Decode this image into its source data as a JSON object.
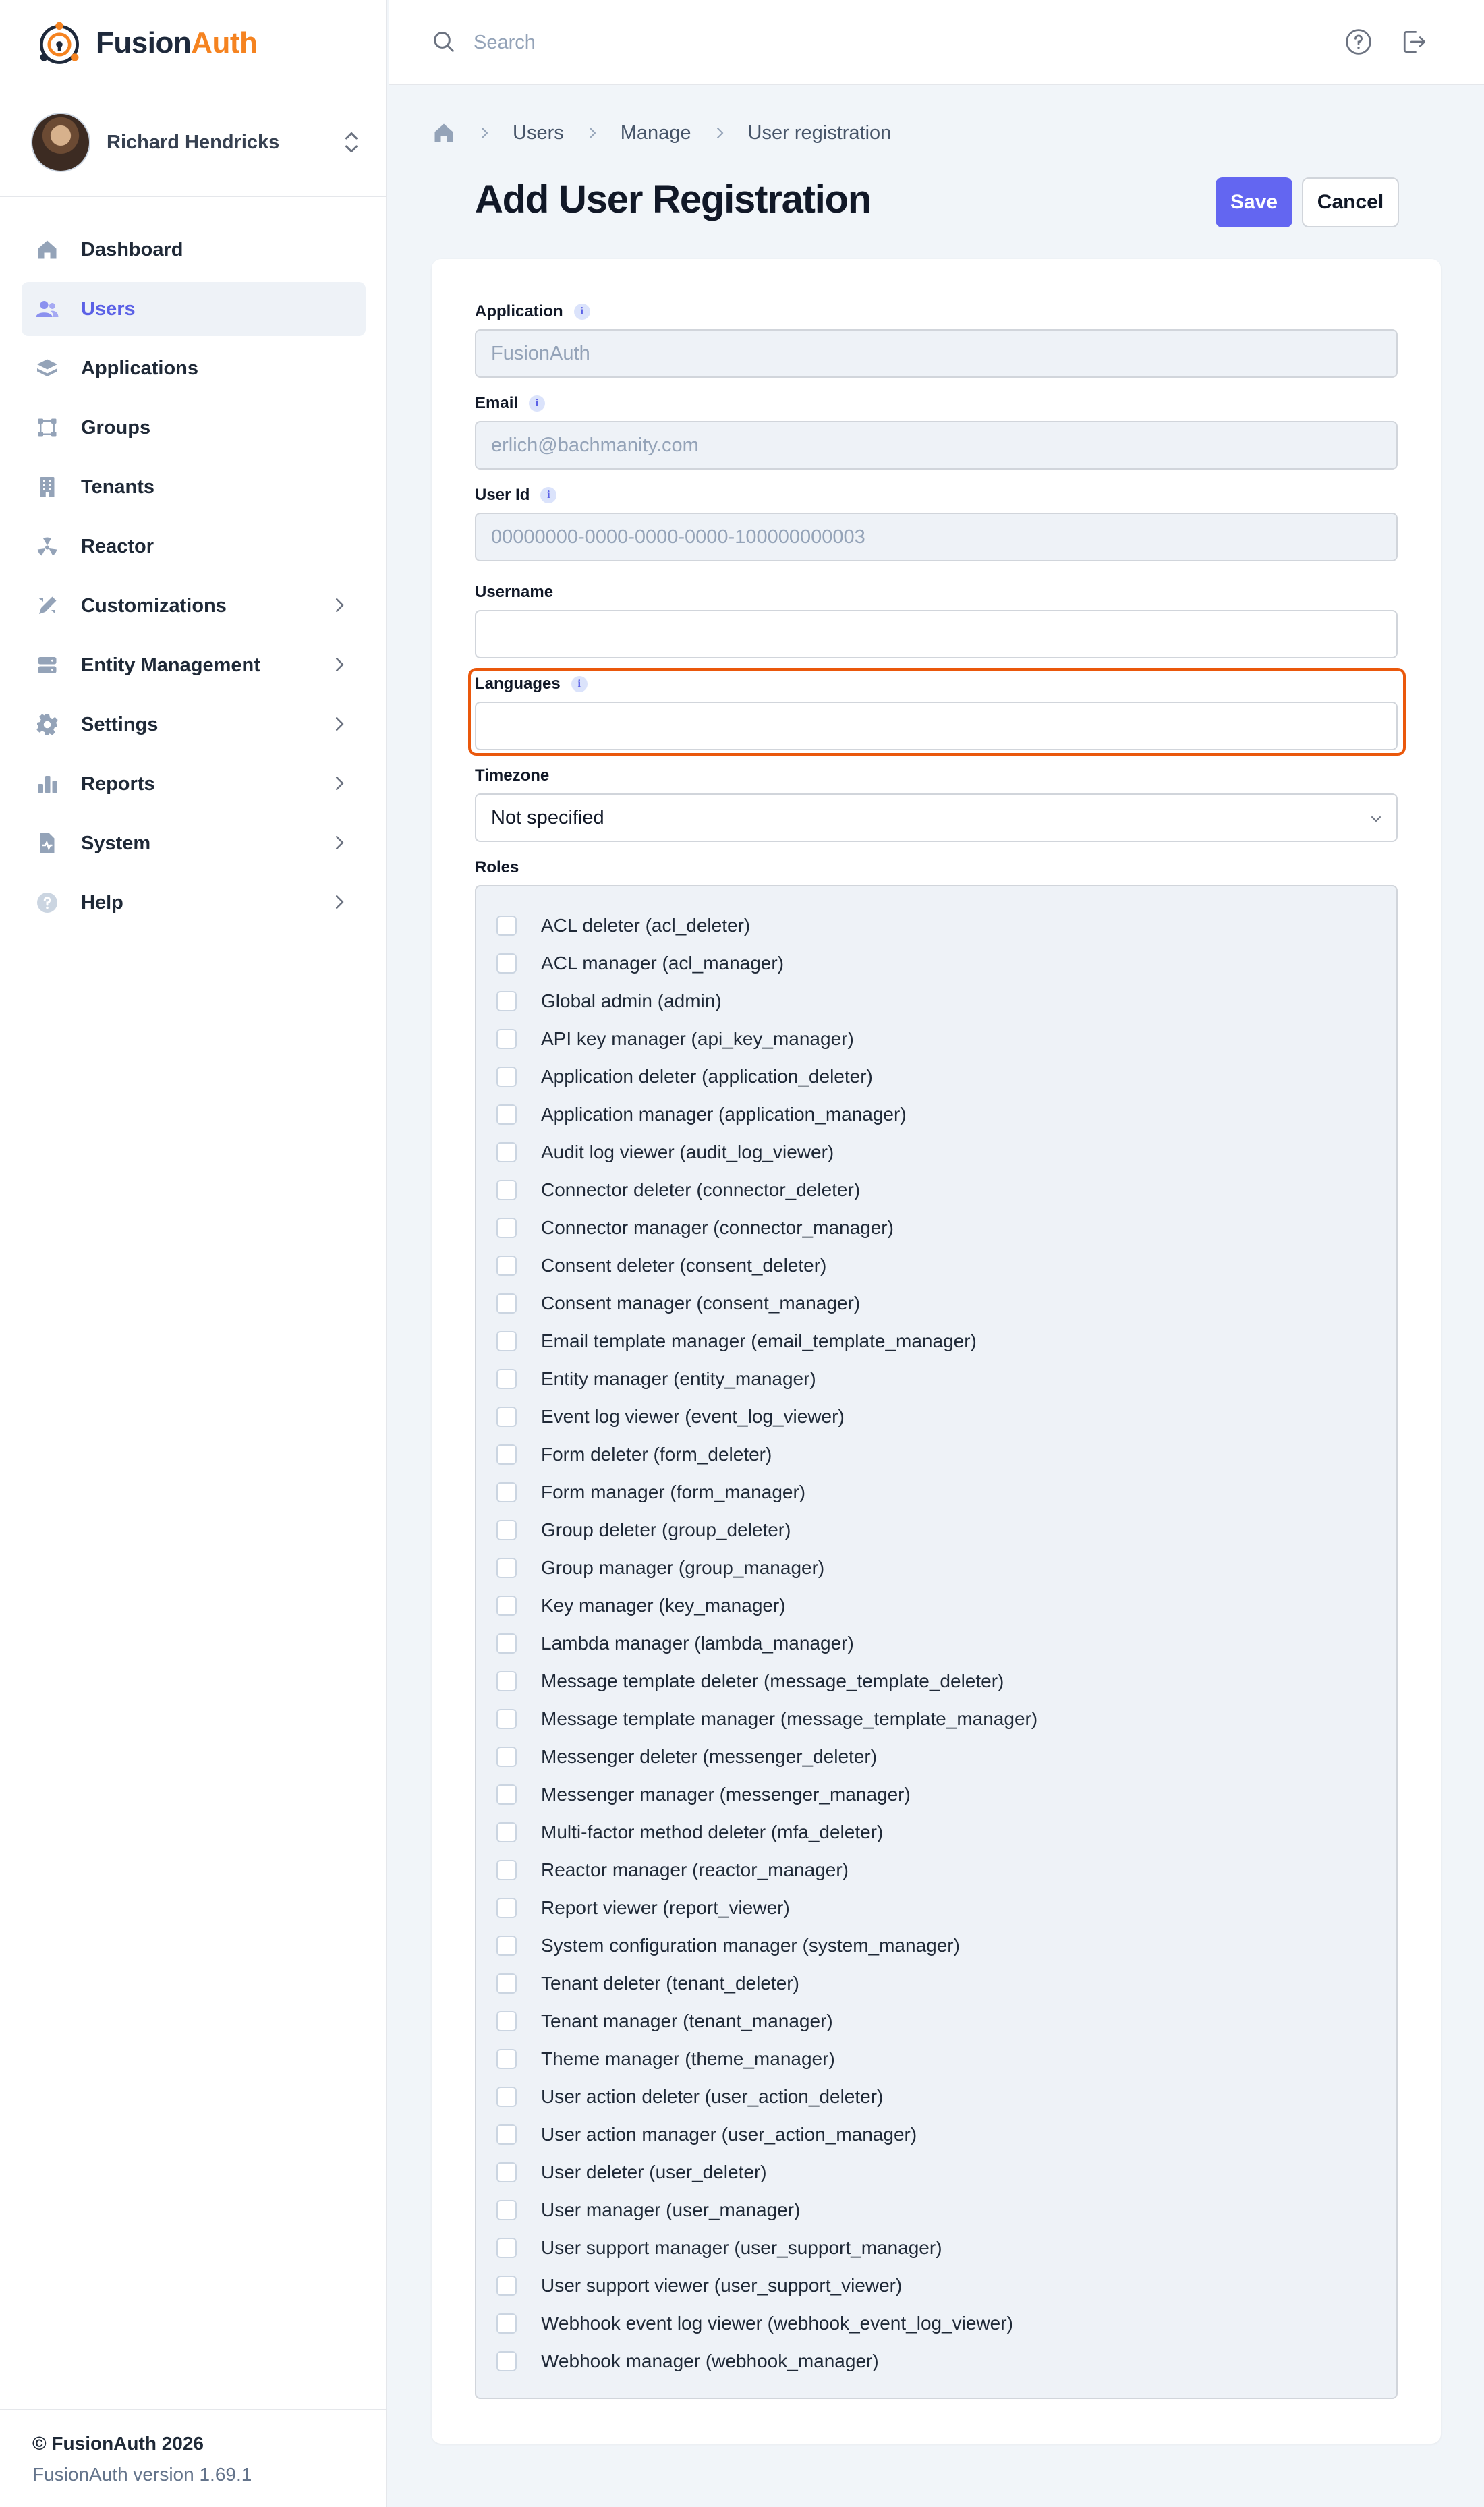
{
  "app": {
    "brand_primary": "Fusion",
    "brand_accent": "Auth",
    "accent_color": "#f58320",
    "primary_color": "#6366f1"
  },
  "user": {
    "name": "Richard Hendricks"
  },
  "nav": {
    "items": [
      {
        "label": "Dashboard",
        "icon": "home-icon"
      },
      {
        "label": "Users",
        "icon": "users-icon"
      },
      {
        "label": "Applications",
        "icon": "layers-icon"
      },
      {
        "label": "Groups",
        "icon": "groups-icon"
      },
      {
        "label": "Tenants",
        "icon": "building-icon"
      },
      {
        "label": "Reactor",
        "icon": "radiation-icon"
      },
      {
        "label": "Customizations",
        "icon": "pencil-ruler-icon"
      },
      {
        "label": "Entity Management",
        "icon": "server-icon"
      },
      {
        "label": "Settings",
        "icon": "gear-icon"
      },
      {
        "label": "Reports",
        "icon": "bar-chart-icon"
      },
      {
        "label": "System",
        "icon": "document-pulse-icon"
      },
      {
        "label": "Help",
        "icon": "question-icon"
      }
    ]
  },
  "footer": {
    "copyright": "© FusionAuth 2026",
    "version": "FusionAuth version 1.69.1"
  },
  "search": {
    "placeholder": "Search"
  },
  "breadcrumb": {
    "items": [
      "Users",
      "Manage",
      "User registration"
    ]
  },
  "page": {
    "title": "Add User Registration",
    "save_label": "Save",
    "cancel_label": "Cancel"
  },
  "form": {
    "application": {
      "label": "Application",
      "value": "FusionAuth"
    },
    "email": {
      "label": "Email",
      "value": "erlich@bachmanity.com"
    },
    "user_id": {
      "label": "User Id",
      "value": "00000000-0000-0000-0000-100000000003"
    },
    "username": {
      "label": "Username",
      "value": ""
    },
    "languages": {
      "label": "Languages",
      "value": ""
    },
    "timezone": {
      "label": "Timezone",
      "value": "Not specified"
    },
    "roles": {
      "label": "Roles",
      "items": [
        "ACL deleter (acl_deleter)",
        "ACL manager (acl_manager)",
        "Global admin (admin)",
        "API key manager (api_key_manager)",
        "Application deleter (application_deleter)",
        "Application manager (application_manager)",
        "Audit log viewer (audit_log_viewer)",
        "Connector deleter (connector_deleter)",
        "Connector manager (connector_manager)",
        "Consent deleter (consent_deleter)",
        "Consent manager (consent_manager)",
        "Email template manager (email_template_manager)",
        "Entity manager (entity_manager)",
        "Event log viewer (event_log_viewer)",
        "Form deleter (form_deleter)",
        "Form manager (form_manager)",
        "Group deleter (group_deleter)",
        "Group manager (group_manager)",
        "Key manager (key_manager)",
        "Lambda manager (lambda_manager)",
        "Message template deleter (message_template_deleter)",
        "Message template manager (message_template_manager)",
        "Messenger deleter (messenger_deleter)",
        "Messenger manager (messenger_manager)",
        "Multi-factor method deleter (mfa_deleter)",
        "Reactor manager (reactor_manager)",
        "Report viewer (report_viewer)",
        "System configuration manager (system_manager)",
        "Tenant deleter (tenant_deleter)",
        "Tenant manager (tenant_manager)",
        "Theme manager (theme_manager)",
        "User action deleter (user_action_deleter)",
        "User action manager (user_action_manager)",
        "User deleter (user_deleter)",
        "User manager (user_manager)",
        "User support manager (user_support_manager)",
        "User support viewer (user_support_viewer)",
        "Webhook event log viewer (webhook_event_log_viewer)",
        "Webhook manager (webhook_manager)"
      ]
    }
  }
}
